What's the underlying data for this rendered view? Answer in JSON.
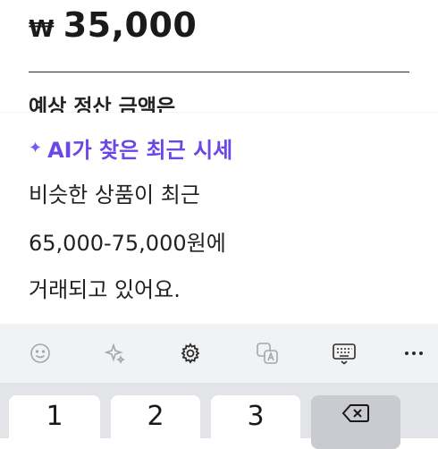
{
  "listing": {
    "currency_symbol": "₩",
    "price": "35,000",
    "settlement_label": "예상 정산 금액은"
  },
  "ai_price_card": {
    "title": "AI가 찾은 최근 시세",
    "line1": "비슷한 상품이 최근",
    "line2": "65,000-75,000원에",
    "line3": "거래되고 있어요.",
    "accent_color": "#6b47e6"
  },
  "keyboard": {
    "toolbar_icons": [
      "emoji-icon",
      "sparkle-icon",
      "gear-icon",
      "translate-icon",
      "keyboard-icon",
      "more-icon"
    ],
    "keys": {
      "k1": "1",
      "k2": "2",
      "k3": "3",
      "delete_icon": "backspace-icon"
    }
  }
}
